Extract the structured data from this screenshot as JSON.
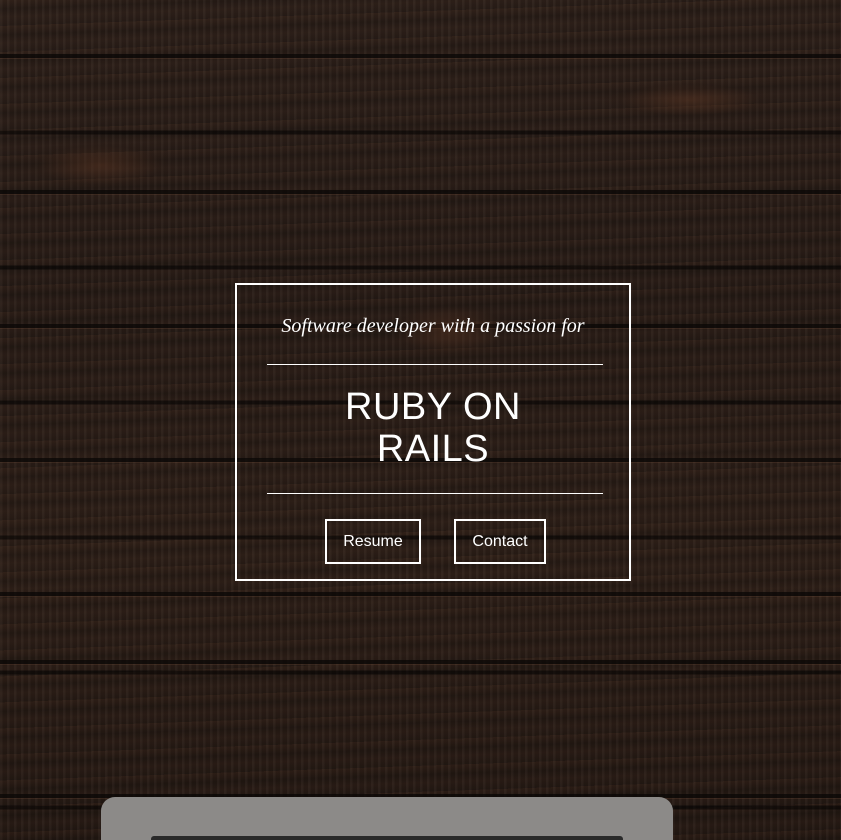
{
  "hero": {
    "tagline": "Software developer with a passion for",
    "headline_line1": "RUBY ON",
    "headline_line2": "RAILS"
  },
  "buttons": {
    "resume_label": "Resume",
    "contact_label": "Contact"
  },
  "colors": {
    "text": "#ffffff",
    "border": "#ffffff",
    "background_wood": "#2a1e18",
    "laptop": "#8c8a88"
  },
  "icons": {
    "laptop": "laptop-icon"
  }
}
